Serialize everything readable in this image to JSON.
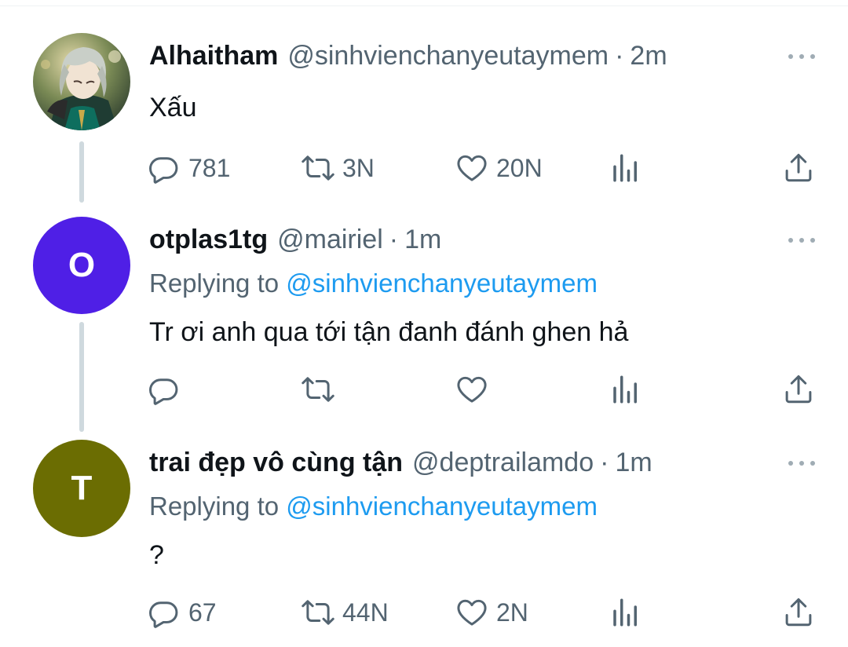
{
  "tweets": [
    {
      "name": "Alhaitham",
      "handle": "@sinhvienchanyeutaymem",
      "separator": "·",
      "time": "2m",
      "text": "Xấu",
      "avatar": {
        "type": "image",
        "description_icon": "profile-picture-icon"
      },
      "replying_prefix": "",
      "replying_mention": "",
      "stats": {
        "replies": "781",
        "retweets": "3N",
        "likes": "20N"
      }
    },
    {
      "name": "otplas1tg",
      "handle": "@mairiel",
      "separator": "·",
      "time": "1m",
      "avatar": {
        "type": "initial",
        "initial": "O",
        "color": "#4f1fe6"
      },
      "replying_prefix": "Replying to ",
      "replying_mention": "@sinhvienchanyeutaymem",
      "text": "Tr ơi anh qua tới tận đanh đánh ghen hả",
      "stats": {
        "replies": "",
        "retweets": "",
        "likes": ""
      }
    },
    {
      "name": "trai đẹp vô cùng tận",
      "handle": "@deptrailamdo",
      "separator": "·",
      "time": "1m",
      "avatar": {
        "type": "initial",
        "initial": "T",
        "color": "#6b6d02"
      },
      "replying_prefix": "Replying to ",
      "replying_mention": "@sinhvienchanyeutaymem",
      "text": "?",
      "stats": {
        "replies": "67",
        "retweets": "44N",
        "likes": "2N"
      }
    }
  ],
  "colors": {
    "text_primary": "#0f1419",
    "text_secondary": "#536471",
    "link": "#1d9bf0",
    "thread_line": "#cfd9de"
  },
  "icons": {
    "reply": "reply-icon",
    "retweet": "retweet-icon",
    "like": "heart-icon",
    "views": "analytics-icon",
    "share": "share-icon",
    "more": "more-icon"
  }
}
